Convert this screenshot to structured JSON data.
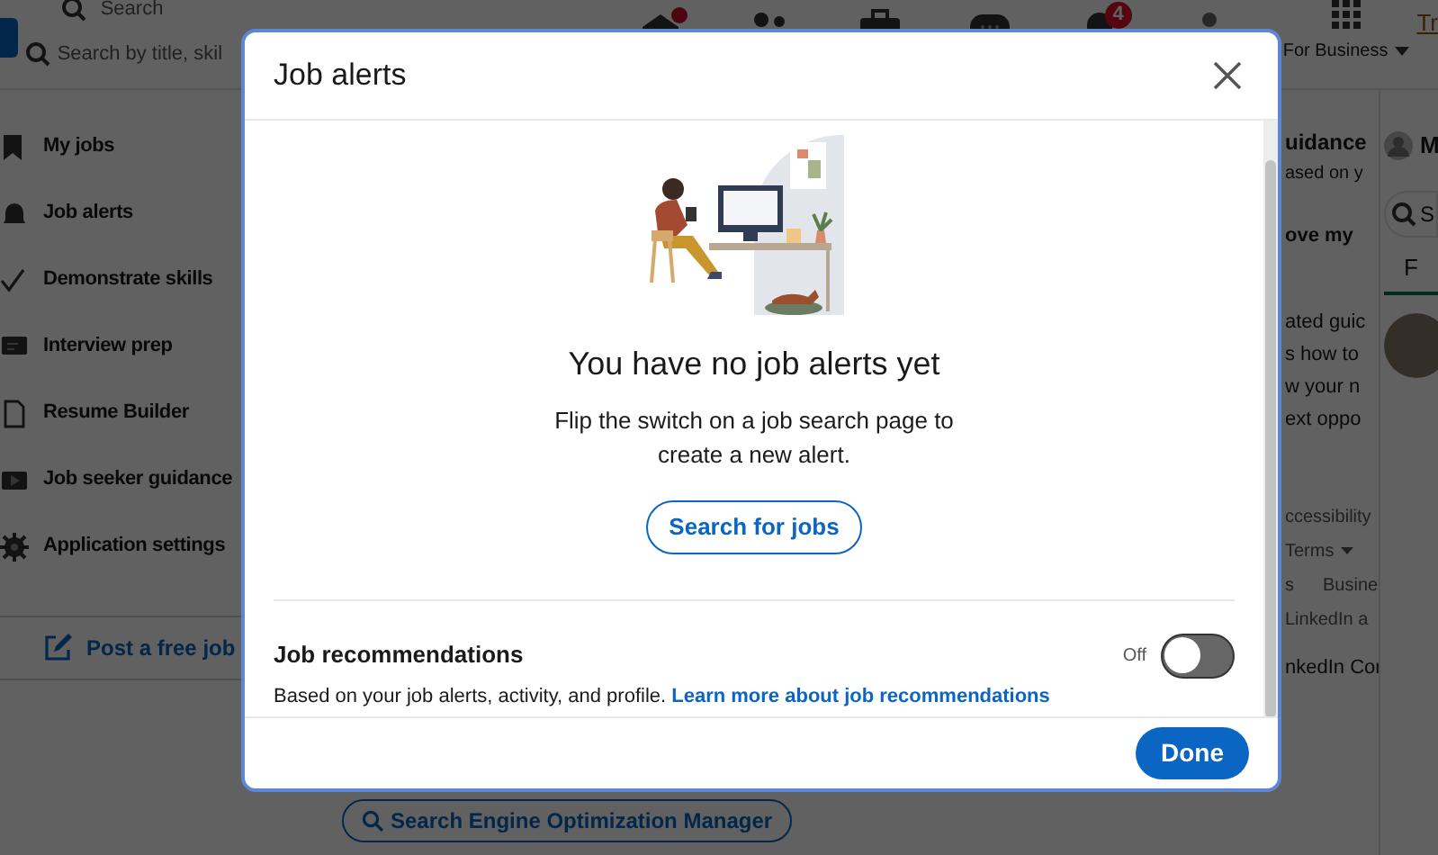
{
  "nav": {
    "search_placeholder": "Search",
    "job_search_placeholder": "Search by title, skil",
    "notification_badge": "4",
    "business_menu": "For Business",
    "premium_link": "Tr"
  },
  "sidebar": {
    "items": [
      {
        "label": "My jobs"
      },
      {
        "label": "Job alerts"
      },
      {
        "label": "Demonstrate skills"
      },
      {
        "label": "Interview prep"
      },
      {
        "label": "Resume Builder"
      },
      {
        "label": "Job seeker guidance"
      },
      {
        "label": "Application settings"
      }
    ],
    "post_job": "Post a free job"
  },
  "center": {
    "guidance_title": "uidance",
    "guidance_subtitle": "ased on y",
    "card_title": "ove my",
    "card_lines": [
      "ated guic",
      "s how to",
      "w your n",
      "ext oppo"
    ],
    "footer_links": [
      "ccessibility",
      "Terms",
      "s",
      "Busine",
      "LinkedIn a"
    ],
    "copyright": "nkedIn Cor",
    "search_chip": "Search Engine Optimization Manager"
  },
  "right_rail": {
    "name": "M",
    "search": "S",
    "tab": "F"
  },
  "modal": {
    "title": "Job alerts",
    "empty_title": "You have no job alerts yet",
    "empty_text": "Flip the switch on a job search page to create a new alert.",
    "search_button": "Search for jobs",
    "recommendations": {
      "title": "Job recommendations",
      "state_label": "Off",
      "on": false,
      "text": "Based on your job alerts, activity, and profile.",
      "link": "Learn more about job recommendations"
    },
    "done_button": "Done"
  }
}
